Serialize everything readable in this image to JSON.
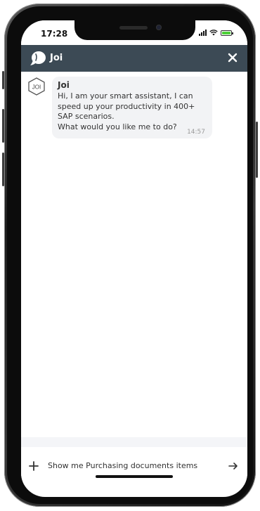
{
  "status_bar": {
    "time": "17:28"
  },
  "header": {
    "title": "Joi",
    "logo_icon": "chat-bubble-icon",
    "close_icon": "close-icon",
    "background_color": "#3c4a55"
  },
  "messages": [
    {
      "sender": "Joi",
      "avatar_label": "JOI",
      "lines": [
        "Hi, I am your smart assistant, I can",
        "speed up your productivity in 400+",
        "SAP scenarios.",
        "What would you like me to do?"
      ],
      "time": "14:57"
    }
  ],
  "input_bar": {
    "add_icon": "plus-icon",
    "suggestion": "Show me Purchasing documents items",
    "send_icon": "arrow-right-icon"
  },
  "colors": {
    "bubble": "#f2f3f5",
    "battery": "#4cd137"
  }
}
